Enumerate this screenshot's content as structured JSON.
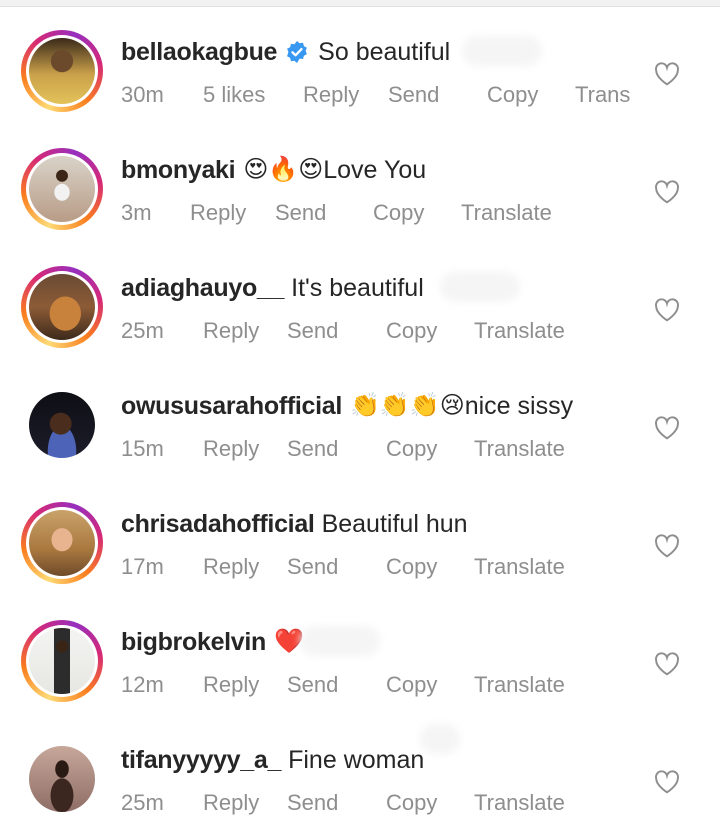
{
  "comments": [
    {
      "username": "bellaokagbue",
      "verified": true,
      "text": "So beautiful",
      "emoji": "",
      "time": "30m",
      "likes": "5 likes",
      "reply": "Reply",
      "send": "Send",
      "copy": "Copy",
      "translate": "Trans"
    },
    {
      "username": "bmonyaki",
      "verified": false,
      "text": "Love You",
      "emoji": "😍🔥😍",
      "time": "3m",
      "likes": "",
      "reply": "Reply",
      "send": "Send",
      "copy": "Copy",
      "translate": "Translate"
    },
    {
      "username": "adiaghauyo__",
      "verified": false,
      "text": "It's beautiful",
      "emoji": "",
      "time": "25m",
      "likes": "",
      "reply": "Reply",
      "send": "Send",
      "copy": "Copy",
      "translate": "Translate"
    },
    {
      "username": "owususarahofficial",
      "verified": false,
      "text": "nice sissy",
      "emoji": "👏👏👏😢",
      "time": "15m",
      "likes": "",
      "reply": "Reply",
      "send": "Send",
      "copy": "Copy",
      "translate": "Translate"
    },
    {
      "username": "chrisadahofficial",
      "verified": false,
      "text": "Beautiful hun",
      "emoji": "",
      "time": "17m",
      "likes": "",
      "reply": "Reply",
      "send": "Send",
      "copy": "Copy",
      "translate": "Translate"
    },
    {
      "username": "bigbrokelvin",
      "verified": false,
      "text": "",
      "emoji": "❤️",
      "time": "12m",
      "likes": "",
      "reply": "Reply",
      "send": "Send",
      "copy": "Copy",
      "translate": "Translate"
    },
    {
      "username": "tifanyyyyy_a_",
      "verified": false,
      "text": "Fine woman",
      "emoji": "",
      "time": "25m",
      "likes": "",
      "reply": "Reply",
      "send": "Send",
      "copy": "Copy",
      "translate": "Translate"
    }
  ],
  "colors": {
    "text": "#262626",
    "meta": "#8e8e8e",
    "verified": "#3897f0",
    "heart_outline": "#8e8e8e"
  }
}
